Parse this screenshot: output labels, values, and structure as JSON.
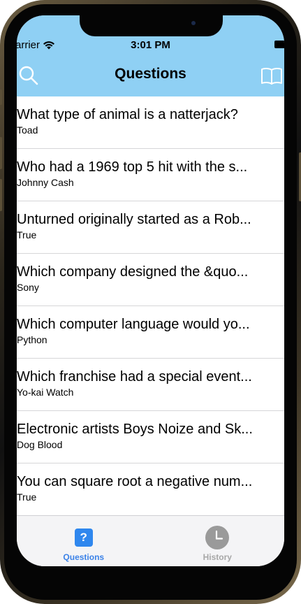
{
  "status_bar": {
    "carrier": "arrier",
    "time": "3:01 PM"
  },
  "nav": {
    "title": "Questions",
    "left_icon": "search-icon",
    "right_icon": "book-icon"
  },
  "questions": [
    {
      "title": "What type of animal is a natterjack?",
      "answer": "Toad"
    },
    {
      "title": "Who had a 1969 top 5 hit with the s...",
      "answer": "Johnny Cash"
    },
    {
      "title": "Unturned originally started as a Rob...",
      "answer": "True"
    },
    {
      "title": "Which company designed the &quo...",
      "answer": "Sony"
    },
    {
      "title": "Which computer language would yo...",
      "answer": "Python"
    },
    {
      "title": "Which franchise had a special event...",
      "answer": "Yo-kai Watch"
    },
    {
      "title": "Electronic artists Boys Noize and Sk...",
      "answer": "Dog Blood"
    },
    {
      "title": "You can square root a negative num...",
      "answer": "True"
    }
  ],
  "tabs": {
    "questions": {
      "label": "Questions",
      "icon": "question-icon",
      "glyph": "?",
      "active": true
    },
    "history": {
      "label": "History",
      "icon": "clock-icon",
      "active": false
    }
  },
  "colors": {
    "header": "#8fd0f4",
    "active_tab": "#3b82e8",
    "inactive_tab": "#a7a7a7"
  }
}
